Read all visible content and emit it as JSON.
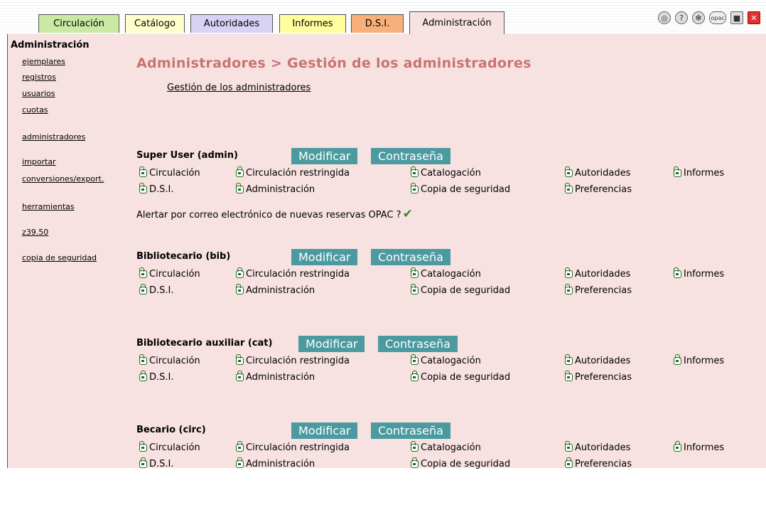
{
  "tabs": [
    {
      "label": "Circulación",
      "color": "#c9e9a5"
    },
    {
      "label": "Catálogo",
      "color": "#ffffcc"
    },
    {
      "label": "Autoridades",
      "color": "#d8d2f4"
    },
    {
      "label": "Informes",
      "color": "#ffff9e"
    },
    {
      "label": "D.S.I.",
      "color": "#f7b07a"
    },
    {
      "label": "Administración",
      "color": "#f7e1e1"
    }
  ],
  "top_icons": [
    "network-icon",
    "help-icon",
    "settings-icon",
    "opac-icon",
    "save-icon",
    "close-icon"
  ],
  "sidebar": {
    "title": "Administración",
    "items": [
      "ejemplares",
      "registros",
      "usuarios",
      "cuotas",
      "administradores",
      "importar",
      "conversiones/export.",
      "herramientas",
      "z39.50",
      "copia de seguridad"
    ]
  },
  "page": {
    "title": "Administradores > Gestión de los administradores",
    "subtitle": "Gestión de los administradores",
    "modify_label": "Modificar",
    "password_label": "Contraseña",
    "alert_label": "Alertar por correo electrónico de nuevas reservas OPAC ?",
    "alert_check": "✔"
  },
  "permission_labels": [
    "Circulación",
    "Circulación restringida",
    "Catalogación",
    "Autoridades",
    "Informes",
    "D.S.I.",
    "Administración",
    "Copia de seguridad",
    "Preferencias"
  ],
  "users": [
    {
      "name": "Super User (admin)",
      "perms": [
        "open",
        "closed",
        "open",
        "open",
        "open",
        "open",
        "open",
        "open",
        "open"
      ],
      "alert": true
    },
    {
      "name": "Bibliotecario (bib)",
      "perms": [
        "open",
        "closed",
        "open",
        "open",
        "open",
        "closed",
        "open",
        "open",
        "open"
      ],
      "alert": false
    },
    {
      "name": "Bibliotecario auxiliar (cat)",
      "perms": [
        "open",
        "open",
        "open",
        "open",
        "closed",
        "closed",
        "closed",
        "closed",
        "open"
      ],
      "alert": false
    },
    {
      "name": "Becario (circ)",
      "perms": [
        "open",
        "closed",
        "open",
        "open",
        "closed",
        "closed",
        "closed",
        "closed",
        "closed"
      ],
      "alert": false
    }
  ],
  "colors": {
    "accent": "#4b9aa0",
    "title": "#c77470",
    "panel": "#f7e1e1",
    "lock": "#1e6e1e"
  }
}
